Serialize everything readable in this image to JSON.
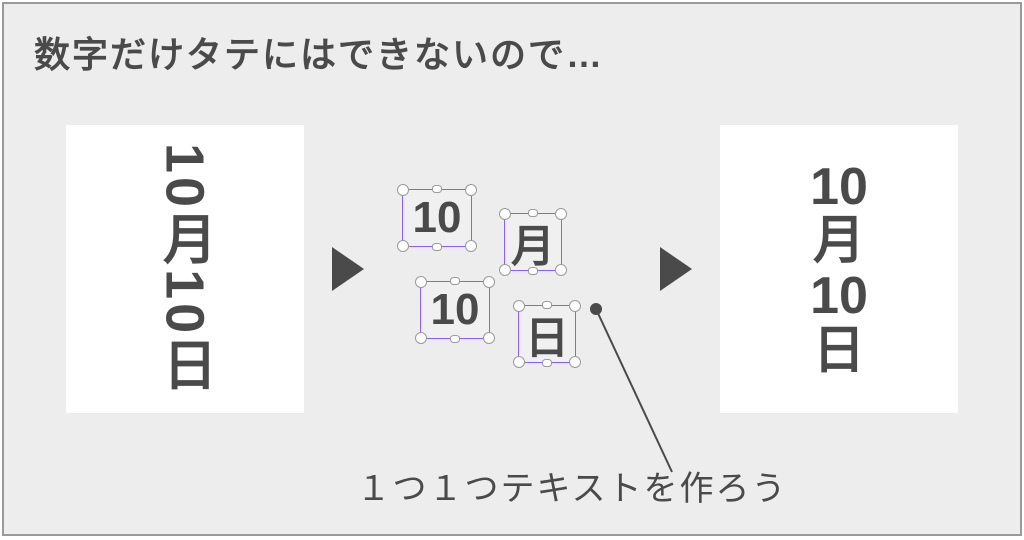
{
  "title": "数字だけタテにはできないので…",
  "left_panel_text": "10月10日",
  "middle_boxes": {
    "box_10a": "10",
    "box_tsuki": "月",
    "box_10b": "10",
    "box_hi": "日"
  },
  "right_panel_stack": [
    "10",
    "月",
    "10",
    "日"
  ],
  "caption": "１つ１つテキストを作ろう"
}
